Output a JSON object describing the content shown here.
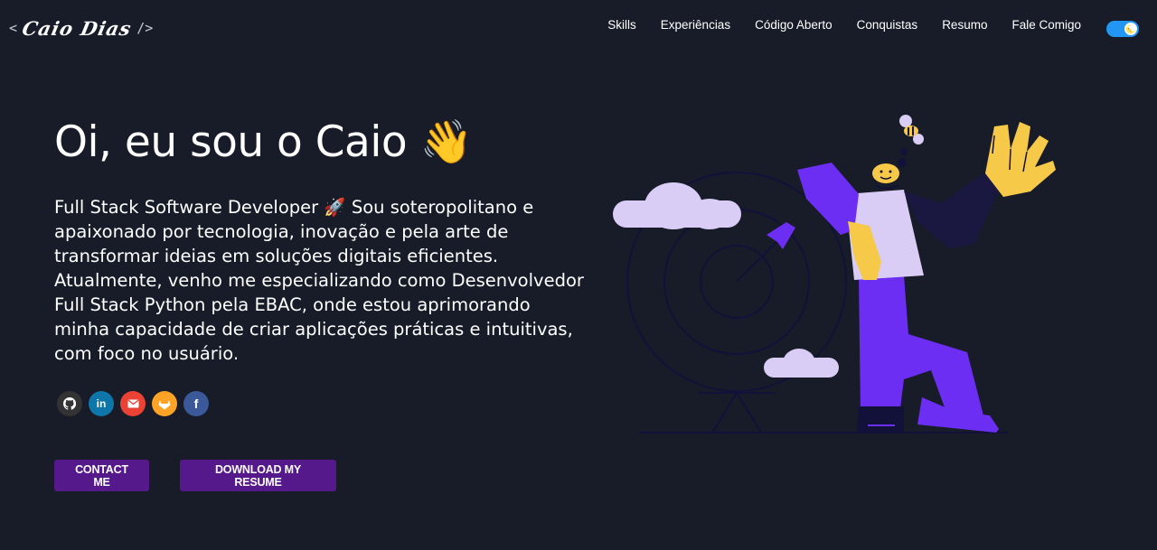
{
  "header": {
    "logo": {
      "open": "<",
      "name": "Caio Dias",
      "close": "/>"
    },
    "nav": [
      {
        "label": "Skills"
      },
      {
        "label": "Experiências"
      },
      {
        "label": "Código Aberto"
      },
      {
        "label": "Conquistas"
      },
      {
        "label": "Resumo"
      },
      {
        "label": "Fale Comigo"
      }
    ],
    "theme_toggle": {
      "icon": "moon-icon",
      "glyph": "🌜",
      "on": true
    }
  },
  "hero": {
    "greeting": "Oi, eu sou o Caio",
    "greeting_emoji": "👋",
    "bio": "Full Stack Software Developer 🚀 Sou soteropolitano e apaixonado por tecnologia, inovação e pela arte de transformar ideias em soluções digitais eficientes. Atualmente, venho me especializando como Desenvolvedor Full Stack Python pela EBAC, onde estou aprimorando minha capacidade de criar aplicações práticas e intuitivas, com foco no usuário.",
    "socials": [
      {
        "icon": "github-icon",
        "color": "#333333"
      },
      {
        "icon": "linkedin-icon",
        "color": "#0e76a8"
      },
      {
        "icon": "email-icon",
        "color": "#ea4335"
      },
      {
        "icon": "gitlab-icon",
        "color": "#fca326"
      },
      {
        "icon": "facebook-icon",
        "color": "#3b5998"
      }
    ],
    "contact_button": "CONTACT ME",
    "resume_button": "DOWNLOAD MY RESUME"
  },
  "colors": {
    "background": "#171c28",
    "button": "#55198b",
    "accent_purple": "#6c2ef2",
    "lavender": "#d9cdf5",
    "skin": "#f7c948",
    "toggle": "#2196f3"
  },
  "illustration": {
    "icon": "developer-target-illustration"
  }
}
